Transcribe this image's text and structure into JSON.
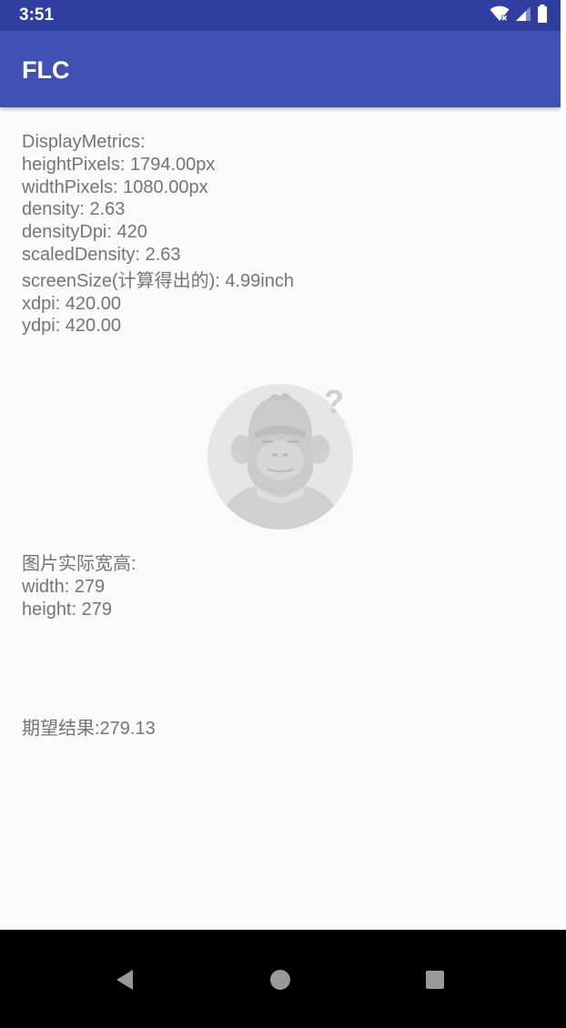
{
  "status_bar": {
    "time": "3:51",
    "icons": [
      "wifi-icon",
      "cell-signal-icon",
      "battery-icon"
    ]
  },
  "app_bar": {
    "title": "FLC",
    "color": "#3f51b5",
    "status_color": "#303f9f"
  },
  "metrics": {
    "header": "DisplayMetrics:",
    "height_pixels": "heightPixels: 1794.00px",
    "width_pixels": "widthPixels: 1080.00px",
    "density": "density: 2.63",
    "density_dpi": "densityDpi: 420",
    "scaled_density": "scaledDensity: 2.63",
    "screen_size": "screenSize(计算得出的): 4.99inch",
    "xdpi": "xdpi: 420.00",
    "ydpi": "ydpi: 420.00"
  },
  "image": {
    "icon": "placeholder-monkey-icon"
  },
  "image_size": {
    "header": "图片实际宽高:",
    "width": "width: 279",
    "height": "height: 279"
  },
  "expected": {
    "text": "期望结果:279.13"
  },
  "nav": {
    "back": "back-icon",
    "home": "home-icon",
    "recents": "recents-icon"
  }
}
